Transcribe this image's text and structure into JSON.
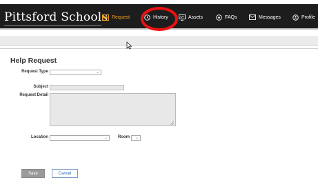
{
  "app": {
    "brand": "Pittsford Schools"
  },
  "nav": {
    "items": [
      {
        "label": "Request",
        "icon": "list-icon",
        "active": true
      },
      {
        "label": "History",
        "icon": "clock-icon",
        "active": false
      },
      {
        "label": "Assets",
        "icon": "monitor-icon",
        "active": false
      },
      {
        "label": "FAQs",
        "icon": "faq-icon",
        "active": false
      },
      {
        "label": "Messages",
        "icon": "envelope-icon",
        "active": false
      },
      {
        "label": "Profile",
        "icon": "user-icon",
        "active": false
      }
    ]
  },
  "form": {
    "title": "Help Request",
    "request_type_label": "Request Type",
    "request_type_value": "",
    "subject_label": "Subject",
    "subject_value": "",
    "detail_label": "Request Detail",
    "detail_value": "",
    "location_label": "Location",
    "location_value": "",
    "room_label": "Room",
    "room_value": "",
    "save_label": "Save",
    "cancel_label": "Cancel"
  },
  "colors": {
    "active": "#f0a020",
    "nav_bg": "#1d1d1d",
    "highlight_circle": "#ee1111"
  }
}
